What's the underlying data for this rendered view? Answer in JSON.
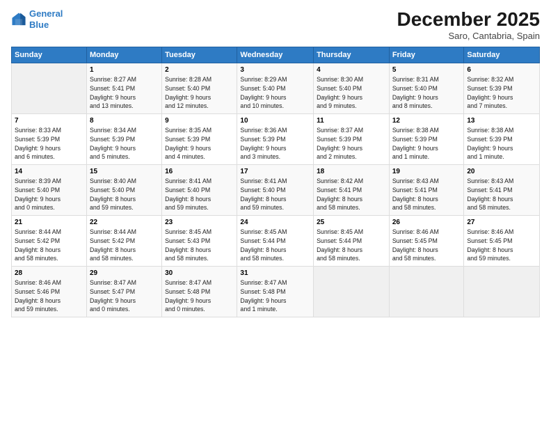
{
  "logo": {
    "line1": "General",
    "line2": "Blue"
  },
  "title": "December 2025",
  "subtitle": "Saro, Cantabria, Spain",
  "weekdays": [
    "Sunday",
    "Monday",
    "Tuesday",
    "Wednesday",
    "Thursday",
    "Friday",
    "Saturday"
  ],
  "weeks": [
    [
      {
        "day": "",
        "info": ""
      },
      {
        "day": "1",
        "info": "Sunrise: 8:27 AM\nSunset: 5:41 PM\nDaylight: 9 hours\nand 13 minutes."
      },
      {
        "day": "2",
        "info": "Sunrise: 8:28 AM\nSunset: 5:40 PM\nDaylight: 9 hours\nand 12 minutes."
      },
      {
        "day": "3",
        "info": "Sunrise: 8:29 AM\nSunset: 5:40 PM\nDaylight: 9 hours\nand 10 minutes."
      },
      {
        "day": "4",
        "info": "Sunrise: 8:30 AM\nSunset: 5:40 PM\nDaylight: 9 hours\nand 9 minutes."
      },
      {
        "day": "5",
        "info": "Sunrise: 8:31 AM\nSunset: 5:40 PM\nDaylight: 9 hours\nand 8 minutes."
      },
      {
        "day": "6",
        "info": "Sunrise: 8:32 AM\nSunset: 5:39 PM\nDaylight: 9 hours\nand 7 minutes."
      }
    ],
    [
      {
        "day": "7",
        "info": "Sunrise: 8:33 AM\nSunset: 5:39 PM\nDaylight: 9 hours\nand 6 minutes."
      },
      {
        "day": "8",
        "info": "Sunrise: 8:34 AM\nSunset: 5:39 PM\nDaylight: 9 hours\nand 5 minutes."
      },
      {
        "day": "9",
        "info": "Sunrise: 8:35 AM\nSunset: 5:39 PM\nDaylight: 9 hours\nand 4 minutes."
      },
      {
        "day": "10",
        "info": "Sunrise: 8:36 AM\nSunset: 5:39 PM\nDaylight: 9 hours\nand 3 minutes."
      },
      {
        "day": "11",
        "info": "Sunrise: 8:37 AM\nSunset: 5:39 PM\nDaylight: 9 hours\nand 2 minutes."
      },
      {
        "day": "12",
        "info": "Sunrise: 8:38 AM\nSunset: 5:39 PM\nDaylight: 9 hours\nand 1 minute."
      },
      {
        "day": "13",
        "info": "Sunrise: 8:38 AM\nSunset: 5:39 PM\nDaylight: 9 hours\nand 1 minute."
      }
    ],
    [
      {
        "day": "14",
        "info": "Sunrise: 8:39 AM\nSunset: 5:40 PM\nDaylight: 9 hours\nand 0 minutes."
      },
      {
        "day": "15",
        "info": "Sunrise: 8:40 AM\nSunset: 5:40 PM\nDaylight: 8 hours\nand 59 minutes."
      },
      {
        "day": "16",
        "info": "Sunrise: 8:41 AM\nSunset: 5:40 PM\nDaylight: 8 hours\nand 59 minutes."
      },
      {
        "day": "17",
        "info": "Sunrise: 8:41 AM\nSunset: 5:40 PM\nDaylight: 8 hours\nand 59 minutes."
      },
      {
        "day": "18",
        "info": "Sunrise: 8:42 AM\nSunset: 5:41 PM\nDaylight: 8 hours\nand 58 minutes."
      },
      {
        "day": "19",
        "info": "Sunrise: 8:43 AM\nSunset: 5:41 PM\nDaylight: 8 hours\nand 58 minutes."
      },
      {
        "day": "20",
        "info": "Sunrise: 8:43 AM\nSunset: 5:41 PM\nDaylight: 8 hours\nand 58 minutes."
      }
    ],
    [
      {
        "day": "21",
        "info": "Sunrise: 8:44 AM\nSunset: 5:42 PM\nDaylight: 8 hours\nand 58 minutes."
      },
      {
        "day": "22",
        "info": "Sunrise: 8:44 AM\nSunset: 5:42 PM\nDaylight: 8 hours\nand 58 minutes."
      },
      {
        "day": "23",
        "info": "Sunrise: 8:45 AM\nSunset: 5:43 PM\nDaylight: 8 hours\nand 58 minutes."
      },
      {
        "day": "24",
        "info": "Sunrise: 8:45 AM\nSunset: 5:44 PM\nDaylight: 8 hours\nand 58 minutes."
      },
      {
        "day": "25",
        "info": "Sunrise: 8:45 AM\nSunset: 5:44 PM\nDaylight: 8 hours\nand 58 minutes."
      },
      {
        "day": "26",
        "info": "Sunrise: 8:46 AM\nSunset: 5:45 PM\nDaylight: 8 hours\nand 58 minutes."
      },
      {
        "day": "27",
        "info": "Sunrise: 8:46 AM\nSunset: 5:45 PM\nDaylight: 8 hours\nand 59 minutes."
      }
    ],
    [
      {
        "day": "28",
        "info": "Sunrise: 8:46 AM\nSunset: 5:46 PM\nDaylight: 8 hours\nand 59 minutes."
      },
      {
        "day": "29",
        "info": "Sunrise: 8:47 AM\nSunset: 5:47 PM\nDaylight: 9 hours\nand 0 minutes."
      },
      {
        "day": "30",
        "info": "Sunrise: 8:47 AM\nSunset: 5:48 PM\nDaylight: 9 hours\nand 0 minutes."
      },
      {
        "day": "31",
        "info": "Sunrise: 8:47 AM\nSunset: 5:48 PM\nDaylight: 9 hours\nand 1 minute."
      },
      {
        "day": "",
        "info": ""
      },
      {
        "day": "",
        "info": ""
      },
      {
        "day": "",
        "info": ""
      }
    ]
  ]
}
